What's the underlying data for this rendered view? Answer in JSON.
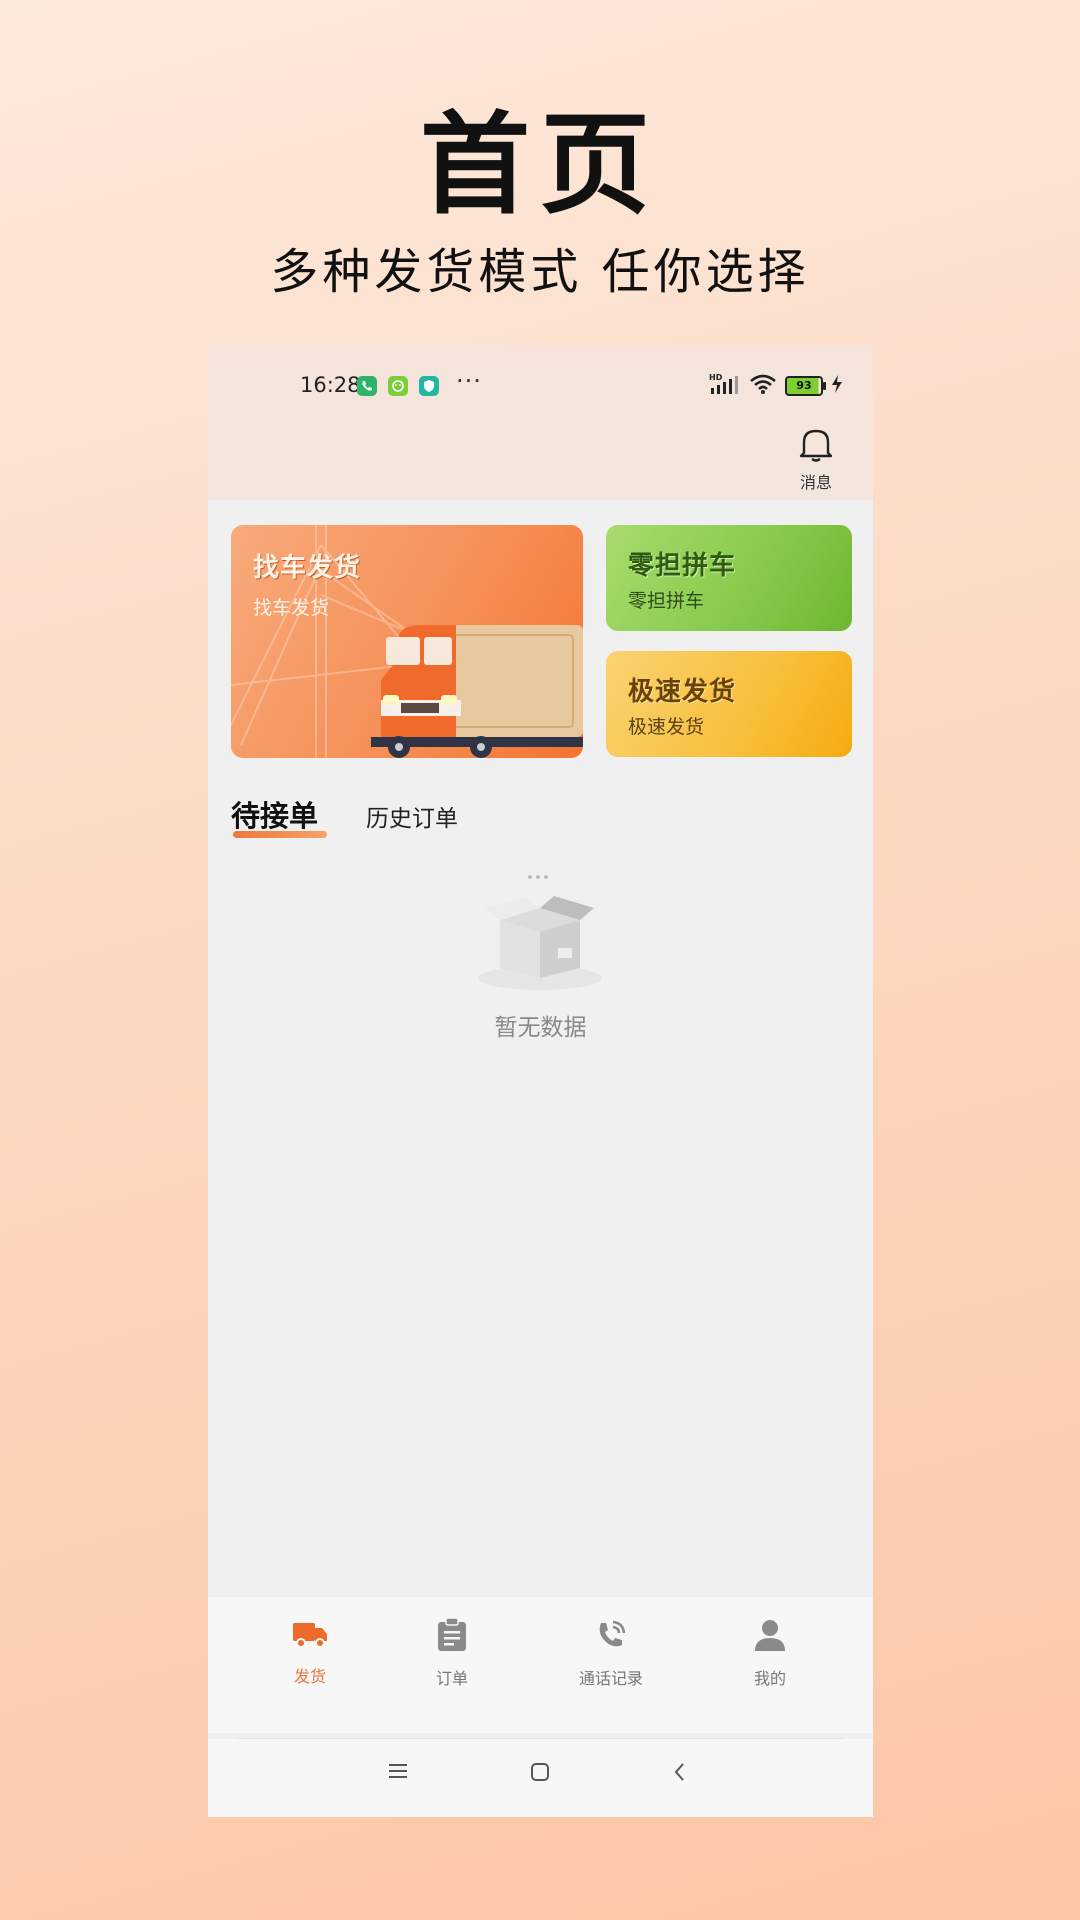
{
  "promo": {
    "title": "首页",
    "subtitle": "多种发货模式 任你选择"
  },
  "status_bar": {
    "time": "16:28",
    "more": "···",
    "network": "HD",
    "battery": "93"
  },
  "header": {
    "message_label": "消息"
  },
  "cards": {
    "find_truck": {
      "title": "找车发货",
      "subtitle": "找车发货"
    },
    "ltl": {
      "title": "零担拼车",
      "subtitle": "零担拼车"
    },
    "express": {
      "title": "极速发货",
      "subtitle": "极速发货"
    }
  },
  "tabs": {
    "active": "待接单",
    "other": "历史订单"
  },
  "empty": {
    "text": "暂无数据"
  },
  "bottom_nav": {
    "items": [
      {
        "label": "发货",
        "icon": "truck-icon",
        "active": true
      },
      {
        "label": "订单",
        "icon": "clipboard-icon",
        "active": false
      },
      {
        "label": "通话记录",
        "icon": "phone-icon",
        "active": false
      },
      {
        "label": "我的",
        "icon": "user-icon",
        "active": false
      }
    ]
  },
  "colors": {
    "accent": "#e9773b",
    "green_card": "#86c94a",
    "yellow_card": "#f8bf3a",
    "orange_card": "#f68d54"
  }
}
